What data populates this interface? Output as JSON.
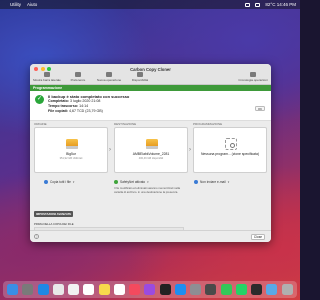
{
  "menubar": {
    "apple": "",
    "items": [
      "Utility",
      "Aiuto"
    ],
    "clock": "82°C 14:46 PM"
  },
  "window": {
    "title": "Carbon Copy Cloner",
    "toolbar": [
      {
        "label": "Mostra barra laterale",
        "icon": "sidebar-icon"
      },
      {
        "label": "Preferenze",
        "icon": "preferences-icon"
      },
      {
        "label": "Nuova operazione",
        "icon": "new-task-icon"
      },
      {
        "label": "Disponibilità",
        "icon": "disks-icon"
      }
    ],
    "toolbar_right": {
      "label": "Cronologia operazioni",
      "icon": "history-icon"
    },
    "section_title": "Programmazione",
    "status": {
      "headline": "Il backup è stato completato con successo",
      "completed_label": "Completato:",
      "completed_value": "3 luglio 2020 21:08",
      "elapsed_label": "Tempo trascorso:",
      "elapsed_value": "14:14",
      "copied_label": "File copiati:",
      "copied_value": "4,67 TCD (23,79 GB)",
      "ok_button": "OK"
    },
    "source": {
      "header": "ORIGINE",
      "name": "Big5ur",
      "sub": "351,92 GB Utilizzati"
    },
    "destination": {
      "header": "DESTINAZIONE",
      "name": "AMBElabkVolume_2281",
      "sub": "400,46 GB disponibili"
    },
    "schedule": {
      "header": "PROGRAMMAZIONE",
      "name": "Nessuna program... (zione specificata)"
    },
    "options": {
      "copy": "Copia tutti i file",
      "safety": "SafetyNet attivato",
      "notify": "Non inviare e-mail",
      "note": "I file modificati ed eliminati saranno memorizzati nella cartella di archivio. in una destinazione la presenza."
    },
    "advanced": {
      "badge": "IMPOSTAZIONI AVANZATE",
      "before": "PRIMA DELLA COPIA DEI FILE"
    },
    "help": "?",
    "close": "Close"
  },
  "dock": [
    {
      "icon": "finder-icon",
      "color": "#3a8ee6"
    },
    {
      "icon": "launchpad-icon",
      "color": "#7a7a7a"
    },
    {
      "icon": "safari-icon",
      "color": "#1e88e5"
    },
    {
      "icon": "chrome-icon",
      "color": "#e8e8e8"
    },
    {
      "icon": "photos-icon",
      "color": "#f2f2f2"
    },
    {
      "icon": "calendar-icon",
      "color": "#ffffff"
    },
    {
      "icon": "notes-icon",
      "color": "#f7d94c"
    },
    {
      "icon": "reminders-icon",
      "color": "#ffffff"
    },
    {
      "icon": "music-icon",
      "color": "#f44a5e"
    },
    {
      "icon": "podcasts-icon",
      "color": "#9b4be0"
    },
    {
      "icon": "appletv-icon",
      "color": "#222222"
    },
    {
      "icon": "appstore-icon",
      "color": "#1e8ef0"
    },
    {
      "icon": "settings-icon",
      "color": "#8e8e93"
    },
    {
      "icon": "ccc-icon",
      "color": "#4a4a4a"
    },
    {
      "icon": "messages-icon",
      "color": "#34c759"
    },
    {
      "icon": "whatsapp-icon",
      "color": "#25d366"
    },
    {
      "icon": "terminal-icon",
      "color": "#2b2b2b"
    },
    {
      "icon": "folder-icon",
      "color": "#5aa9e6"
    },
    {
      "icon": "trash-icon",
      "color": "#b0b0b0"
    }
  ]
}
